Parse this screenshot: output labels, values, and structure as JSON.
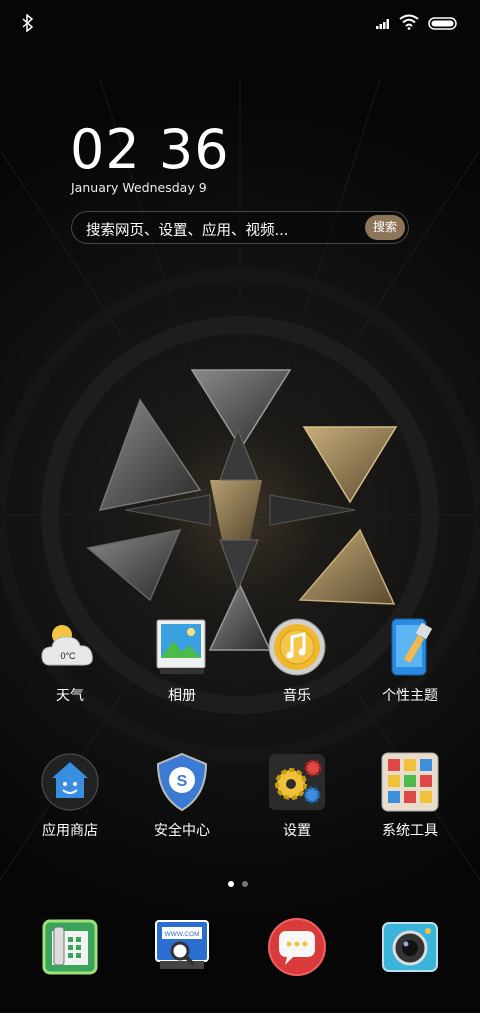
{
  "status_bar": {
    "icons": [
      "bluetooth-icon",
      "signal-icon",
      "wifi-icon",
      "battery-icon"
    ]
  },
  "clock": {
    "time": "02 36",
    "date": "January Wednesday 9"
  },
  "search": {
    "placeholder": "搜索网页、设置、应用、视频...",
    "button_label": "搜索"
  },
  "apps_row1": [
    {
      "label": "天气",
      "icon": "weather-icon",
      "icon_text": "0°C"
    },
    {
      "label": "相册",
      "icon": "gallery-icon"
    },
    {
      "label": "音乐",
      "icon": "music-icon"
    },
    {
      "label": "个性主题",
      "icon": "themes-icon"
    }
  ],
  "apps_row2": [
    {
      "label": "应用商店",
      "icon": "app-store-icon"
    },
    {
      "label": "安全中心",
      "icon": "security-icon"
    },
    {
      "label": "设置",
      "icon": "settings-icon"
    },
    {
      "label": "系统工具",
      "icon": "system-tools-icon"
    }
  ],
  "page_indicator": {
    "pages": 2,
    "current": 1
  },
  "dock": [
    {
      "icon": "phone-icon"
    },
    {
      "icon": "browser-icon",
      "icon_text": "WWW.COM"
    },
    {
      "icon": "messages-icon"
    },
    {
      "icon": "camera-icon"
    }
  ],
  "colors": {
    "accent": "#8d7559",
    "background": "#0a0a0a"
  }
}
